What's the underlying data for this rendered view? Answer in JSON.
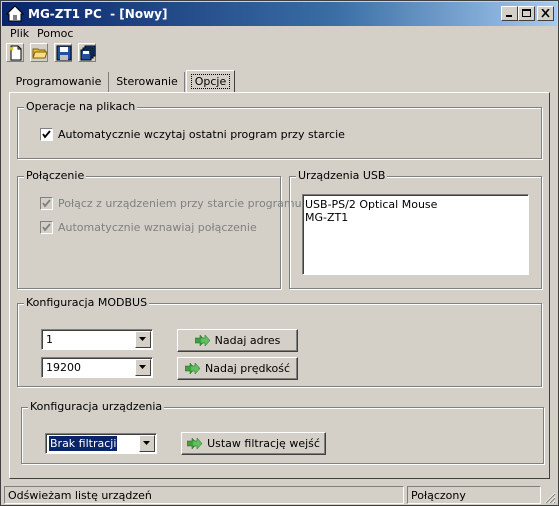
{
  "window": {
    "title": "MG-ZT1 PC  - [Nowy]",
    "title_color": "#0a246a"
  },
  "menu": {
    "items": [
      "Plik",
      "Pomoc"
    ]
  },
  "toolbar": {
    "icons": [
      "new-file-icon",
      "open-folder-icon",
      "save-icon",
      "save-all-icon"
    ]
  },
  "tabs": [
    "Programowanie",
    "Sterowanie",
    "Opcje"
  ],
  "active_tab": "Opcje",
  "file_ops": {
    "title": "Operacje na plikach",
    "autoload_label": "Automatycznie wczytaj ostatni program przy starcie",
    "autoload_checked": true
  },
  "connection": {
    "title": "Połączenie",
    "connect_label": "Połącz z urządzeniem przy starcie programu",
    "connect_checked": true,
    "resume_label": "Automatycznie wznawiaj połączenie",
    "resume_checked": true
  },
  "usb": {
    "title": "Urządzenia USB",
    "devices": [
      "USB-PS/2 Optical Mouse",
      "MG-ZT1"
    ]
  },
  "modbus": {
    "title": "Konfiguracja MODBUS",
    "address_value": "1",
    "address_button": "Nadaj adres",
    "speed_value": "19200",
    "speed_button": "Nadaj prędkość"
  },
  "device_config": {
    "title": "Konfiguracja urządzenia",
    "filter_value": "Brak filtracji",
    "filter_button": "Ustaw filtrację wejść"
  },
  "status": {
    "message": "Odświeżam listę urządzeń",
    "connection": "Połączony"
  }
}
